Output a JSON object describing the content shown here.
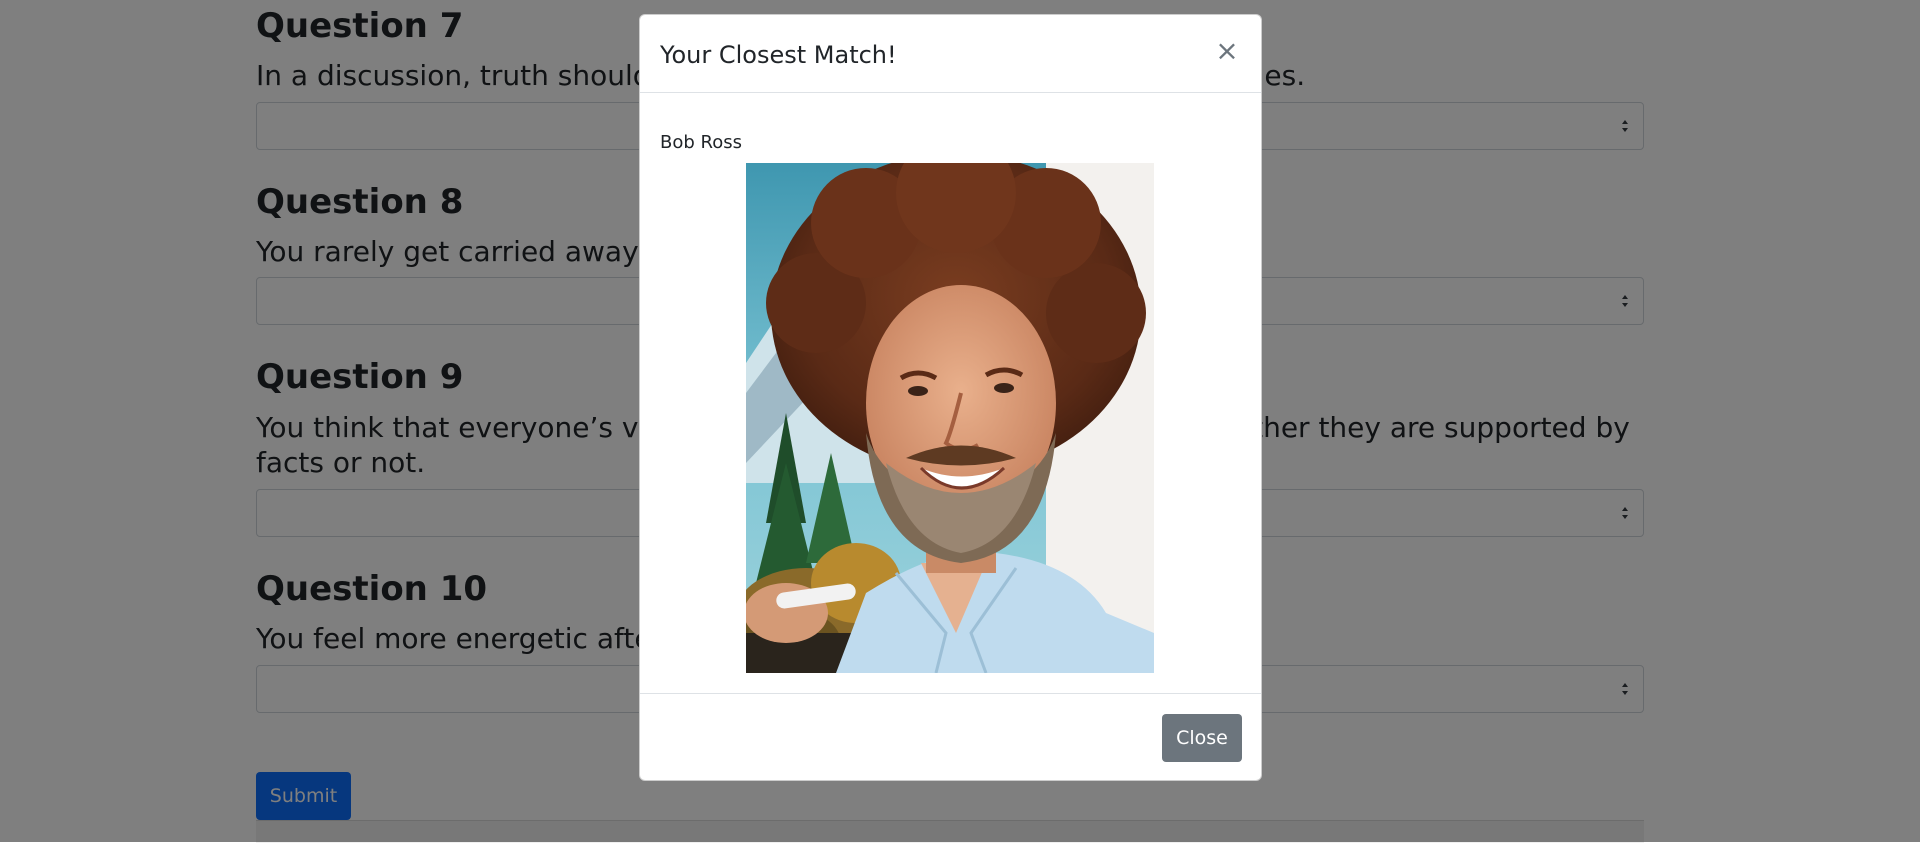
{
  "questions": [
    {
      "title": "Question 7",
      "text": "In a discussion, truth should be more important than people's sensitivities."
    },
    {
      "title": "Question 8",
      "text": "You rarely get carried away by fantasies and ideas."
    },
    {
      "title": "Question 9",
      "text": "You think that everyone’s views should be respected regardless of whether they are supported by facts or not."
    },
    {
      "title": "Question 10",
      "text": "You feel more energetic after spending time with a group of people."
    }
  ],
  "submit_label": "Submit",
  "modal": {
    "title": "Your Closest Match!",
    "close_icon": "×",
    "match_name": "Bob Ross",
    "close_label": "Close"
  },
  "colors": {
    "primary": "#0d6efd",
    "secondary": "#6c757d",
    "backdrop": "rgba(0,0,0,0.5)"
  }
}
